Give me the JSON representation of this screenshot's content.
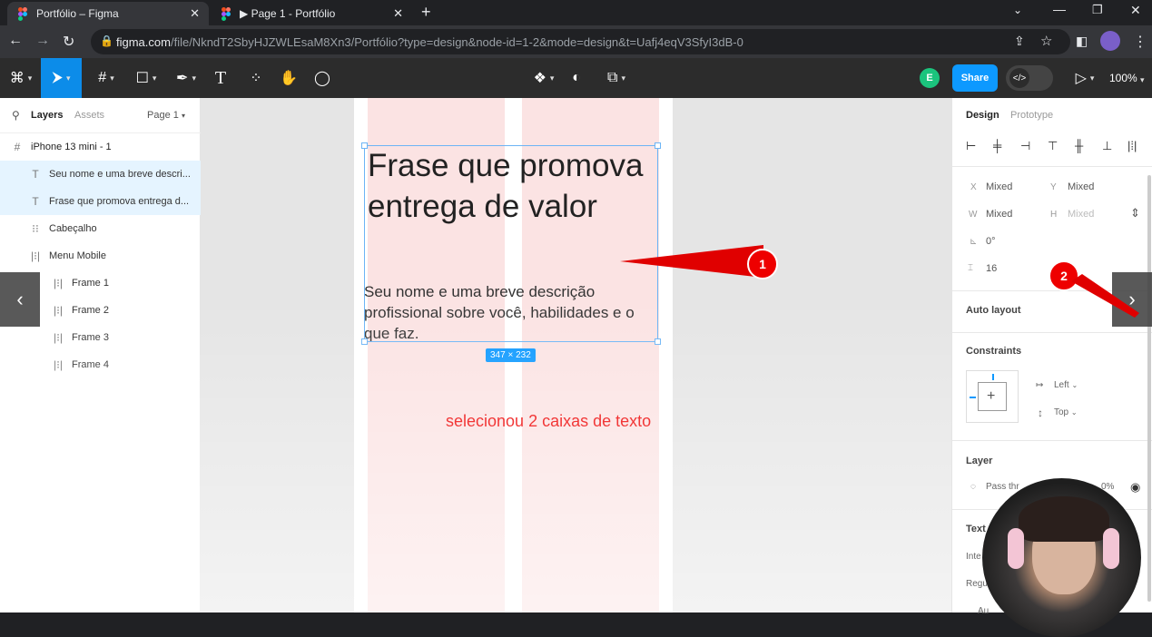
{
  "browser": {
    "tabs": [
      {
        "title": "Portfólio – Figma",
        "active": true
      },
      {
        "title": "▶ Page 1 - Portfólio",
        "active": false
      }
    ],
    "new_tab": "+",
    "url_host": "figma.com",
    "url_path": "/file/NkndT2SbyHJZWLEsaM8Xn3/Portfólio?type=design&node-id=1-2&mode=design&t=Uafj4eqV3SfyI3dB-0"
  },
  "toolbar": {
    "share_label": "Share",
    "user_initial": "E",
    "zoom": "100%",
    "dev_mode_label": "</>"
  },
  "left_panel": {
    "tabs": {
      "layers": "Layers",
      "assets": "Assets",
      "page": "Page 1"
    },
    "frame_name": "iPhone 13 mini - 1",
    "layers": [
      {
        "label": "Seu nome e uma breve descri...",
        "icon": "text-icon",
        "glyph": "T",
        "indent": 1,
        "selected": true
      },
      {
        "label": "Frase que promova entrega d...",
        "icon": "text-icon",
        "glyph": "T",
        "indent": 1,
        "selected": true
      },
      {
        "label": "Cabeçalho",
        "icon": "autolayout-icon",
        "glyph": "⁝⁝",
        "indent": 1,
        "selected": false
      },
      {
        "label": "Menu Mobile",
        "icon": "autolayout-icon",
        "glyph": "|⁝|",
        "indent": 1,
        "selected": false
      },
      {
        "label": "Frame 1",
        "icon": "autolayout-icon",
        "glyph": "|⁝|",
        "indent": 2,
        "selected": false
      },
      {
        "label": "Frame 2",
        "icon": "autolayout-icon",
        "glyph": "|⁝|",
        "indent": 2,
        "selected": false
      },
      {
        "label": "Frame 3",
        "icon": "autolayout-icon",
        "glyph": "|⁝|",
        "indent": 2,
        "selected": false
      },
      {
        "label": "Frame 4",
        "icon": "autolayout-icon",
        "glyph": "|⁝|",
        "indent": 2,
        "selected": false
      }
    ]
  },
  "canvas": {
    "headline": "Frase que promova entrega de valor",
    "subtext": "Seu nome e uma breve descrição profissional sobre você, habilidades e o que faz.",
    "selection_size": "347 × 232",
    "annotation": "selecionou 2 caixas de texto",
    "markers": [
      "1",
      "2"
    ],
    "colors": {
      "column": "#fbe3e3",
      "selection": "#6cb4f5",
      "annotation": "#e00000"
    }
  },
  "right_panel": {
    "tabs": {
      "design": "Design",
      "prototype": "Prototype"
    },
    "x_label": "X",
    "x_value": "Mixed",
    "y_label": "Y",
    "y_value": "Mixed",
    "w_label": "W",
    "w_value": "Mixed",
    "h_label": "H",
    "h_value": "Mixed",
    "rotation": "0°",
    "radius": "16",
    "auto_layout": "Auto layout",
    "constraints": "Constraints",
    "constraint_h": "Left",
    "constraint_v": "Top",
    "layer": "Layer",
    "pass_through": "Pass thr",
    "opacity_partial": "0%",
    "text": "Text",
    "inter_partial": "Inte",
    "regular_partial": "Regu",
    "auto_partial": "Au"
  }
}
